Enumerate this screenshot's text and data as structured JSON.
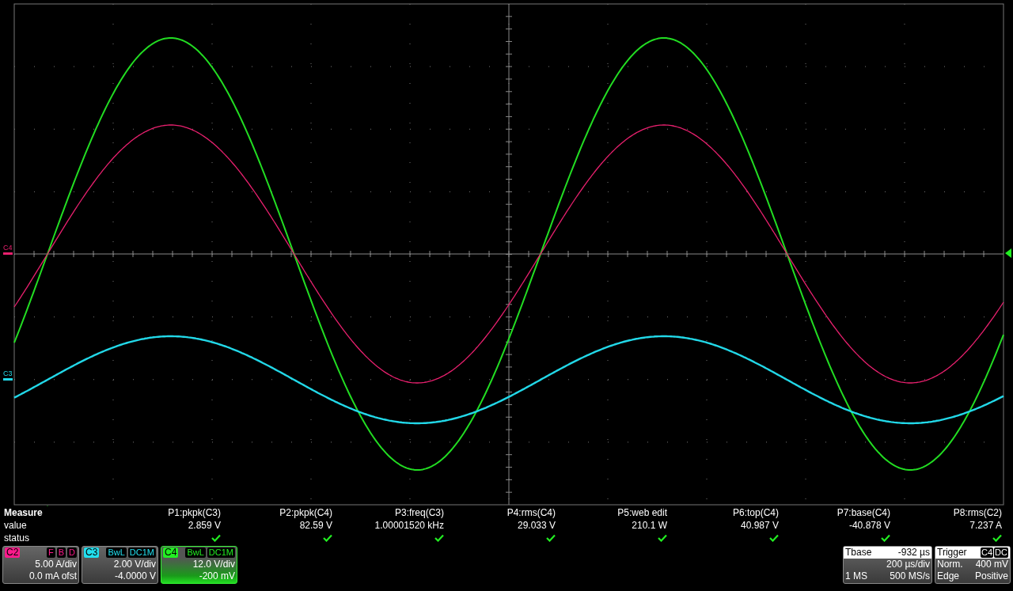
{
  "trace_markers": [
    {
      "label": "C4",
      "color": "#e8206e"
    },
    {
      "label": "C3",
      "color": "#22d8e8"
    }
  ],
  "measure": {
    "title": "Measure",
    "row_labels": [
      "value",
      "status"
    ],
    "items": [
      {
        "name": "P1:pkpk(C3)",
        "value": "2.859 V",
        "ok": true
      },
      {
        "name": "P2:pkpk(C4)",
        "value": "82.59 V",
        "ok": true
      },
      {
        "name": "P3:freq(C3)",
        "value": "1.00001520 kHz",
        "ok": true
      },
      {
        "name": "P4:rms(C4)",
        "value": "29.033 V",
        "ok": true
      },
      {
        "name": "P5:web edit",
        "value": "210.1 W",
        "ok": true
      },
      {
        "name": "P6:top(C4)",
        "value": "40.987 V",
        "ok": true
      },
      {
        "name": "P7:base(C4)",
        "value": "-40.878 V",
        "ok": true
      },
      {
        "name": "P8:rms(C2)",
        "value": "7.237 A",
        "ok": true
      }
    ]
  },
  "channels": [
    {
      "name": "C2",
      "color": "#ff1a8c",
      "tags": [
        "F",
        "B",
        "D"
      ],
      "scale": "5.00 A/div",
      "offset": "0.0 mA ofst",
      "selected": false
    },
    {
      "name": "C3",
      "color": "#22e0f0",
      "tags": [
        "BwL",
        "DC1M"
      ],
      "scale": "2.00 V/div",
      "offset": "-4.0000 V",
      "selected": false
    },
    {
      "name": "C4",
      "color": "#22ee22",
      "tags": [
        "BwL",
        "DC1M"
      ],
      "scale": "12.0 V/div",
      "offset": "-200 mV",
      "selected": true
    }
  ],
  "timebase": {
    "title": "Tbase",
    "delay": "-932 µs",
    "scale": "200 µs/div",
    "memory": "1 MS",
    "rate": "500 MS/s"
  },
  "trigger": {
    "title": "Trigger",
    "tags": [
      "C4",
      "DC"
    ],
    "mode": "Norm.",
    "threshold": "400 mV",
    "type": "Edge",
    "slope": "Positive"
  }
}
